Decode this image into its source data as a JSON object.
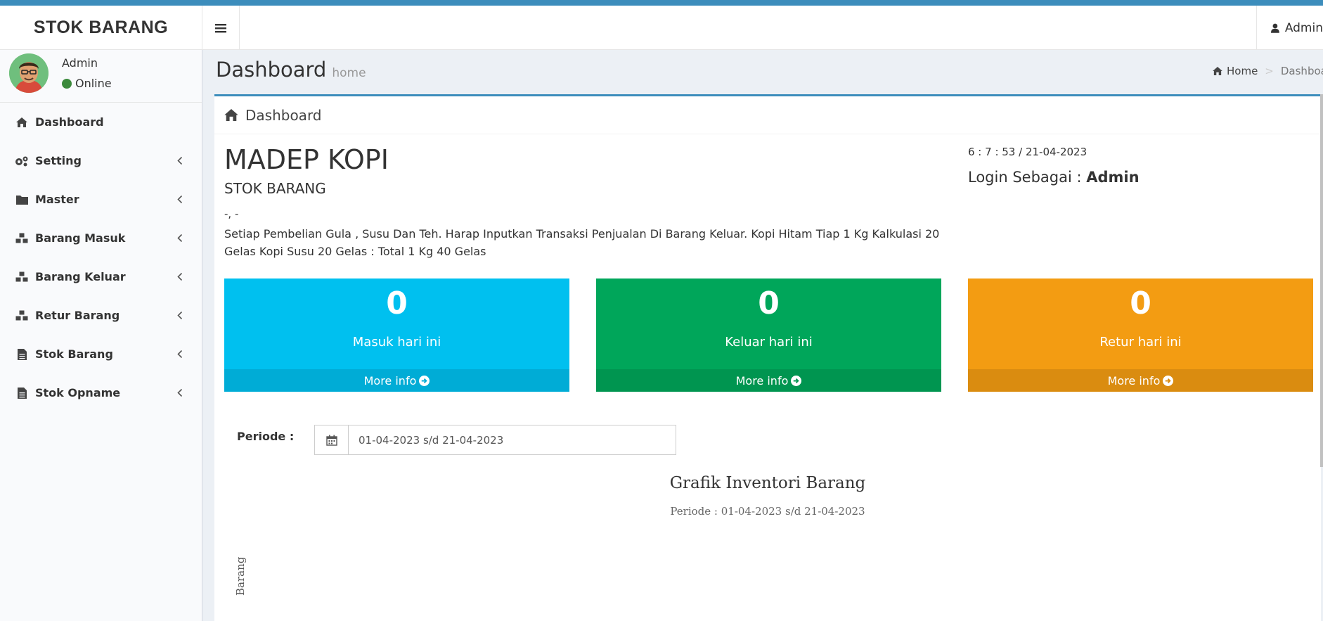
{
  "header": {
    "logo": "STOK BARANG",
    "user_label": "Admin"
  },
  "sidebar": {
    "user_name": "Admin",
    "user_status": "Online",
    "items": [
      {
        "label": "Dashboard",
        "icon": "home-icon",
        "has_submenu": false
      },
      {
        "label": "Setting",
        "icon": "gears-icon",
        "has_submenu": true
      },
      {
        "label": "Master",
        "icon": "folder-icon",
        "has_submenu": true
      },
      {
        "label": "Barang Masuk",
        "icon": "cubes-icon",
        "has_submenu": true
      },
      {
        "label": "Barang Keluar",
        "icon": "cubes-icon",
        "has_submenu": true
      },
      {
        "label": "Retur Barang",
        "icon": "cubes-icon",
        "has_submenu": true
      },
      {
        "label": "Stok Barang",
        "icon": "file-text-icon",
        "has_submenu": true
      },
      {
        "label": "Stok Opname",
        "icon": "file-text-icon",
        "has_submenu": true
      }
    ]
  },
  "page": {
    "title": "Dashboard",
    "subtitle": "home",
    "breadcrumb": [
      "Home",
      "Dashboard"
    ]
  },
  "box": {
    "title": "Dashboard",
    "company": "MADEP KOPI",
    "subtitle": "STOK BARANG",
    "address": "-, -",
    "note": "Setiap Pembelian Gula , Susu Dan Teh. Harap Inputkan Transaksi Penjualan Di Barang Keluar. Kopi Hitam Tiap 1 Kg Kalkulasi 20 Gelas Kopi Susu 20 Gelas : Total 1 Kg 40 Gelas",
    "clock": "6 : 7 : 53 / 21-04-2023",
    "login_prefix": "Login Sebagai :",
    "login_user": "Admin"
  },
  "stats": [
    {
      "value": "0",
      "label": "Masuk hari ini",
      "footer": "More info",
      "color": "#00c0ef"
    },
    {
      "value": "0",
      "label": "Keluar hari ini",
      "footer": "More info",
      "color": "#00a65a"
    },
    {
      "value": "0",
      "label": "Retur hari ini",
      "footer": "More info",
      "color": "#f39c12"
    }
  ],
  "periode": {
    "label": "Periode :",
    "value": "01-04-2023 s/d 21-04-2023"
  },
  "chart": {
    "title": "Grafik Inventori Barang",
    "subtitle": "Periode : 01-04-2023 s/d 21-04-2023",
    "y_label": "Barang"
  }
}
